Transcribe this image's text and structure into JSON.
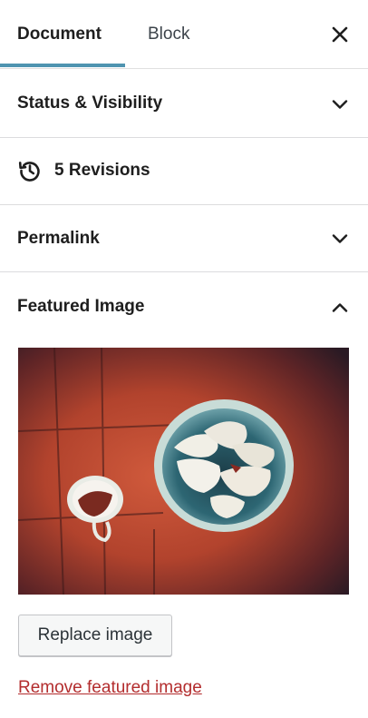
{
  "tabs": {
    "document": "Document",
    "block": "Block",
    "active": "Document"
  },
  "panels": {
    "status_visibility": {
      "title": "Status & Visibility",
      "expanded": false
    },
    "revisions": {
      "label": "5 Revisions"
    },
    "permalink": {
      "title": "Permalink",
      "expanded": false
    },
    "featured_image": {
      "title": "Featured Image",
      "expanded": true,
      "replace_label": "Replace image",
      "remove_label": "Remove featured image"
    }
  },
  "icons": {
    "close": "close-icon",
    "chevron_down": "chevron-down-icon",
    "chevron_up": "chevron-up-icon",
    "revisions": "history-icon"
  },
  "colors": {
    "tab_indicator": "#4f94b0",
    "remove_link": "#b32d2e",
    "divider": "#dcdcde"
  }
}
